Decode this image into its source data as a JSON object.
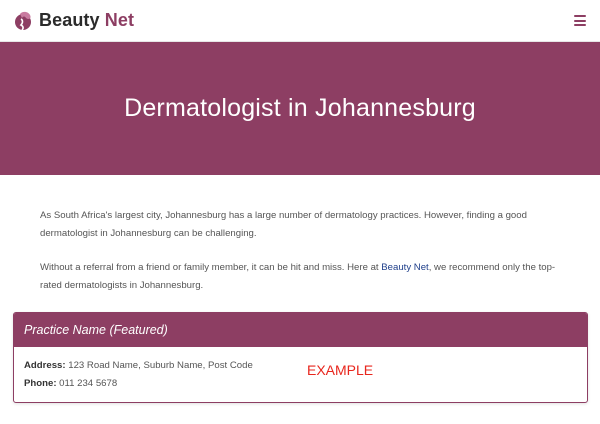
{
  "header": {
    "brand_part1": "Beauty ",
    "brand_part2": "Net",
    "brand_color": "#8d3e63",
    "logo_icon": "beauty-face-icon",
    "menu_icon": "hamburger-menu-icon"
  },
  "hero": {
    "title": "Dermatologist in Johannesburg",
    "background": "#8d3e63"
  },
  "intro": {
    "p1": "As South Africa's largest city, Johannesburg has a large number of dermatology practices. However, finding a good dermatologist in Johannesburg can be challenging.",
    "p2_before": "Without a referral from a friend or family member, it can be hit and miss. Here at ",
    "p2_link": "Beauty Net",
    "p2_after": ", we recommend only the top-rated dermatologists in Johannesburg."
  },
  "listing": {
    "title": "Practice Name (Featured)",
    "address_label": "Address:",
    "address_value": " 123 Road Name, Suburb Name, Post Code",
    "phone_label": "Phone:",
    "phone_value": " 011 234 5678",
    "badge": "EXAMPLE",
    "badge_color": "#e8261d"
  }
}
